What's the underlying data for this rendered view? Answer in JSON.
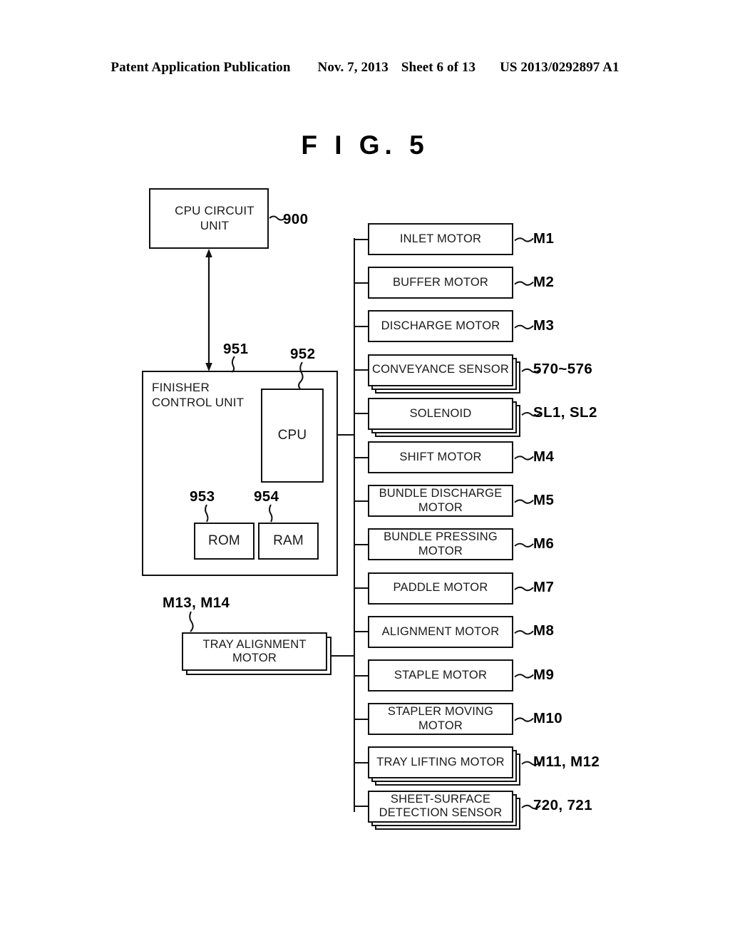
{
  "header": {
    "publication": "Patent Application Publication",
    "date": "Nov. 7, 2013",
    "sheet": "Sheet 6 of 13",
    "patent_number": "US 2013/0292897 A1"
  },
  "figure": {
    "title": "F I G.  5"
  },
  "blocks": {
    "cpu_circuit_unit": {
      "label": "CPU CIRCUIT UNIT",
      "ref": "900"
    },
    "finisher_control_unit": {
      "label": "FINISHER\nCONTROL UNIT",
      "line1": "FINISHER",
      "line2": "CONTROL UNIT",
      "ref": "951"
    },
    "cpu": {
      "label": "CPU",
      "ref": "952"
    },
    "rom": {
      "label": "ROM",
      "ref": "953"
    },
    "ram": {
      "label": "RAM",
      "ref": "954"
    },
    "tray_alignment_motor": {
      "line1": "TRAY ALIGNMENT",
      "line2": "MOTOR",
      "ref": "M13, M14"
    }
  },
  "peripherals": [
    {
      "line1": "INLET MOTOR",
      "line2": "",
      "ref": "M1",
      "stacked": false
    },
    {
      "line1": "BUFFER MOTOR",
      "line2": "",
      "ref": "M2",
      "stacked": false
    },
    {
      "line1": "DISCHARGE MOTOR",
      "line2": "",
      "ref": "M3",
      "stacked": false
    },
    {
      "line1": "CONVEYANCE SENSOR",
      "line2": "",
      "ref": "570~576",
      "stacked": true
    },
    {
      "line1": "SOLENOID",
      "line2": "",
      "ref": "SL1, SL2",
      "stacked": true
    },
    {
      "line1": "SHIFT MOTOR",
      "line2": "",
      "ref": "M4",
      "stacked": false
    },
    {
      "line1": "BUNDLE DISCHARGE",
      "line2": "MOTOR",
      "ref": "M5",
      "stacked": false
    },
    {
      "line1": "BUNDLE PRESSING",
      "line2": "MOTOR",
      "ref": "M6",
      "stacked": false
    },
    {
      "line1": "PADDLE MOTOR",
      "line2": "",
      "ref": "M7",
      "stacked": false
    },
    {
      "line1": "ALIGNMENT MOTOR",
      "line2": "",
      "ref": "M8",
      "stacked": false
    },
    {
      "line1": "STAPLE MOTOR",
      "line2": "",
      "ref": "M9",
      "stacked": false
    },
    {
      "line1": "STAPLER MOVING",
      "line2": "MOTOR",
      "ref": "M10",
      "stacked": false
    },
    {
      "line1": "TRAY LIFTING MOTOR",
      "line2": "",
      "ref": "M11, M12",
      "stacked": true
    },
    {
      "line1": "SHEET-SURFACE",
      "line2": "DETECTION SENSOR",
      "ref": "720, 721",
      "stacked": true
    }
  ],
  "colors": {
    "ink": "#111111",
    "text": "#1a1a1a",
    "paper": "#ffffff"
  }
}
